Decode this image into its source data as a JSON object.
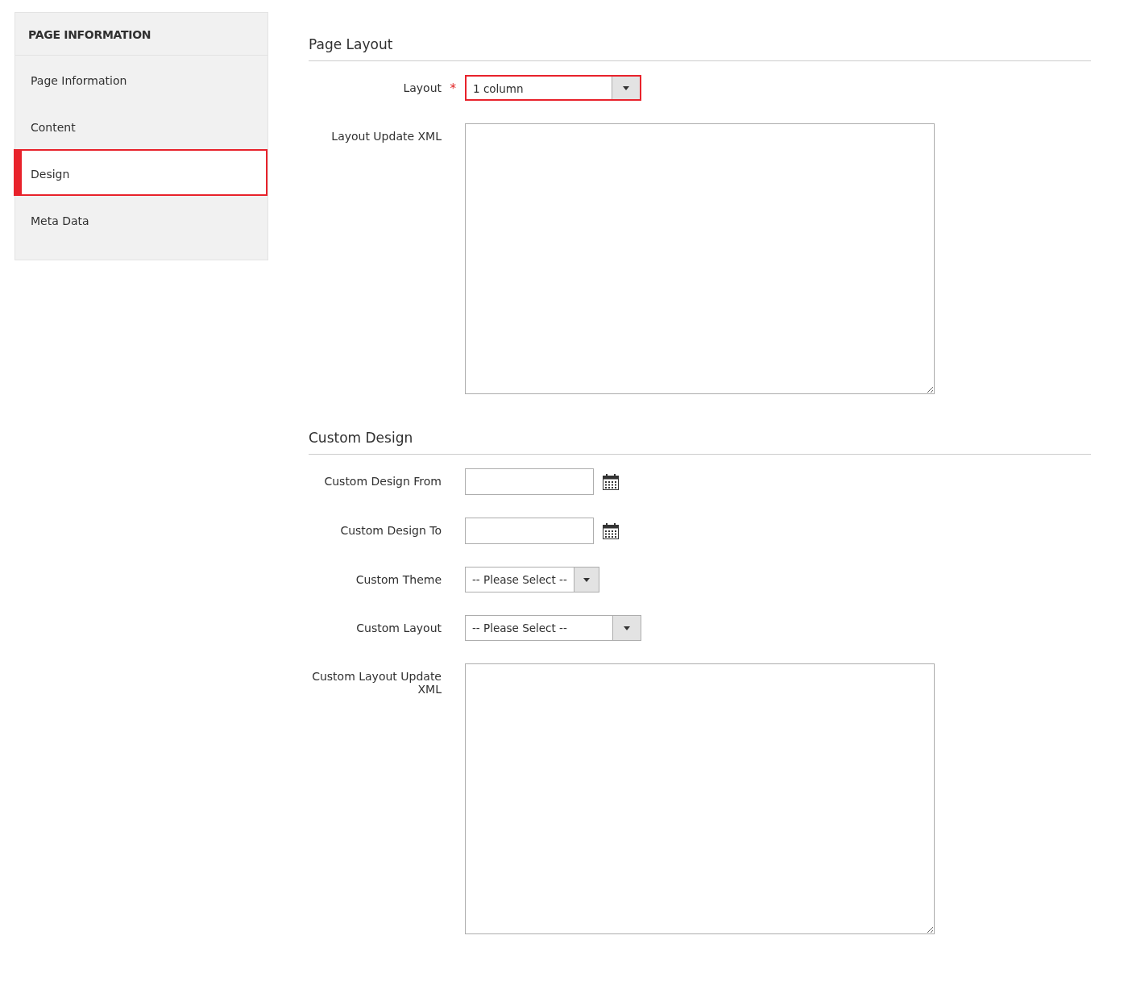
{
  "sidebar": {
    "title": "PAGE INFORMATION",
    "items": [
      {
        "label": "Page Information",
        "highlighted": false
      },
      {
        "label": "Content",
        "highlighted": false
      },
      {
        "label": "Design",
        "highlighted": true
      },
      {
        "label": "Meta Data",
        "highlighted": false
      }
    ]
  },
  "sections": [
    {
      "title": "Page Layout",
      "fields": [
        {
          "kind": "select",
          "label": "Layout",
          "required_mark": "*",
          "value": "1 column",
          "highlighted": true
        },
        {
          "kind": "textarea",
          "label": "Layout Update XML",
          "highlighted": false
        }
      ]
    },
    {
      "title": "Custom Design",
      "fields": [
        {
          "kind": "date",
          "label": "Custom Design From",
          "highlighted": false
        },
        {
          "kind": "date",
          "label": "Custom Design To",
          "highlighted": false
        },
        {
          "kind": "compact-select",
          "label": "Custom Theme",
          "value": "-- Please Select --",
          "highlighted": false
        },
        {
          "kind": "select",
          "label": "Custom Layout",
          "value": "-- Please Select --",
          "highlighted": false
        },
        {
          "kind": "textarea",
          "label": "Custom Layout Update XML",
          "highlighted": false
        }
      ]
    }
  ]
}
